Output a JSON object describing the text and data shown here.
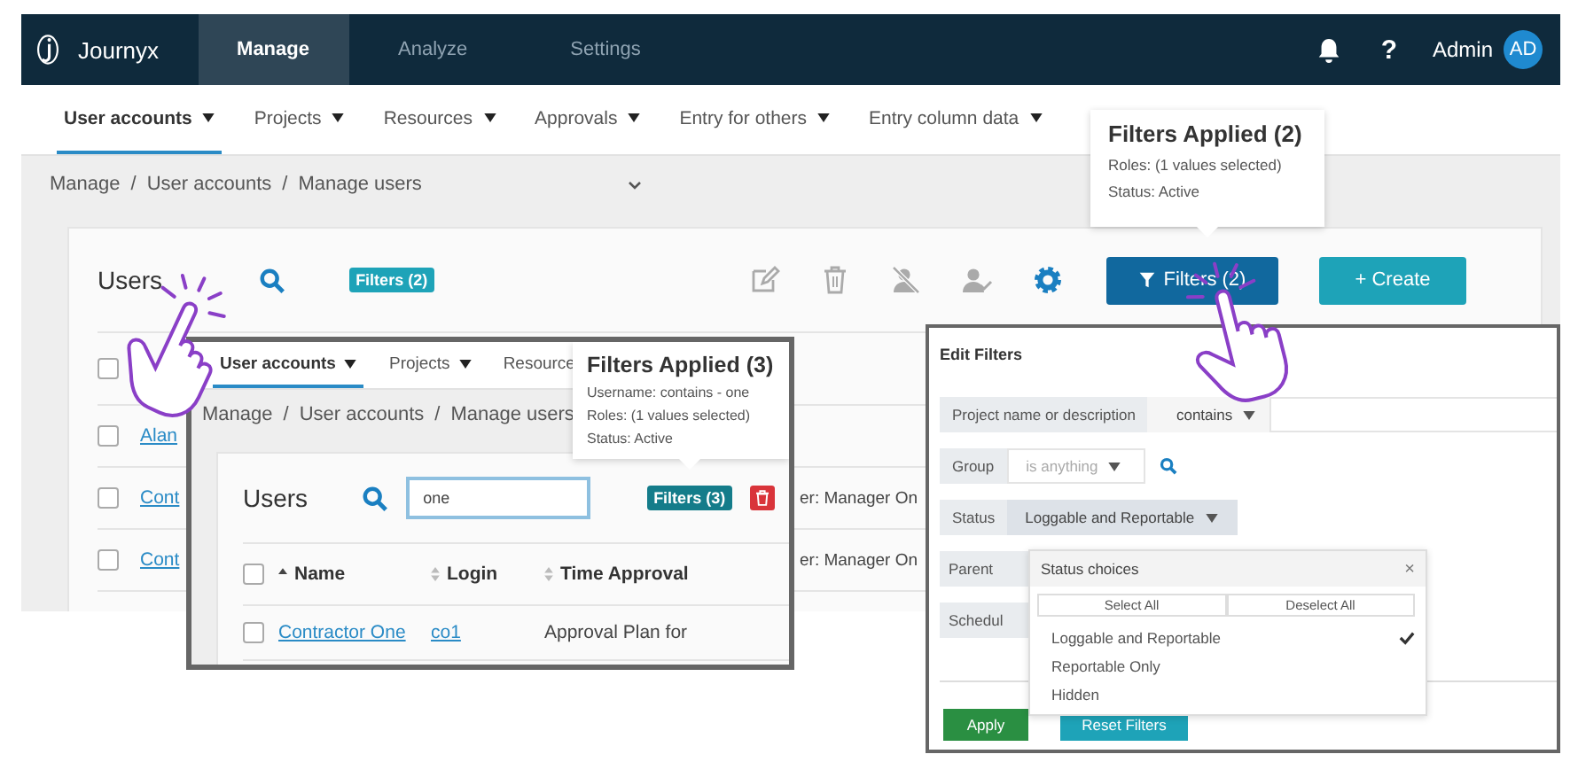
{
  "top_bar": {
    "brand": "Journyx",
    "tabs": [
      {
        "label": "Manage",
        "selected": true
      },
      {
        "label": "Analyze",
        "selected": false
      },
      {
        "label": "Settings",
        "selected": false
      }
    ],
    "help": "?",
    "user": "Admin",
    "avatar": "AD"
  },
  "subnav": [
    {
      "label": "User accounts",
      "selected": true
    },
    {
      "label": "Projects",
      "selected": false
    },
    {
      "label": "Resources",
      "selected": false
    },
    {
      "label": "Approvals",
      "selected": false
    },
    {
      "label": "Entry for others",
      "selected": false
    },
    {
      "label": "Entry column data",
      "selected": false
    }
  ],
  "breadcrumb": {
    "items": [
      "Manage",
      "User accounts",
      "Manage users"
    ],
    "separator": "/"
  },
  "filters_tooltip": {
    "title": "Filters Applied (2)",
    "lines": [
      "Roles: (1 values selected)",
      "Status: Active"
    ]
  },
  "users_card": {
    "title": "Users",
    "filter_badge": "Filters (2)",
    "filters_button": "Filters (2)",
    "create_button": "+ Create",
    "header_checked": false,
    "rows": [
      {
        "name": "Alan",
        "checked": false
      },
      {
        "name": "Cont",
        "column_3": "er: Manager On",
        "checked": false
      },
      {
        "name": "Cont",
        "column_3": "er: Manager On",
        "checked": false
      }
    ]
  },
  "search_inset": {
    "subnav": [
      {
        "label": "User accounts",
        "selected": true,
        "menu": true
      },
      {
        "label": "Projects",
        "selected": false,
        "menu": true
      },
      {
        "label": "Resource",
        "selected": false,
        "menu": false
      }
    ],
    "breadcrumb": {
      "items": [
        "Manage",
        "User accounts",
        "Manage users"
      ],
      "separator": "/"
    },
    "tooltip": {
      "title": "Filters Applied (3)",
      "lines": [
        "Username: contains - one",
        "Roles: (1 values selected)",
        "Status: Active"
      ]
    },
    "title": "Users",
    "search_value": "one",
    "filter_badge": "Filters (3)",
    "header_checked": false,
    "columns": [
      {
        "label": "Name",
        "sorted": true
      },
      {
        "label": "Login",
        "sorted": false
      },
      {
        "label": "Time Approval",
        "sorted": false
      }
    ],
    "rows": [
      {
        "name": "Contractor One",
        "login": "co1",
        "column_3": "Approval Plan for",
        "checked": false
      }
    ]
  },
  "edit_filters": {
    "title": "Edit Filters",
    "rows": [
      {
        "kind": "operator-input",
        "label": "Project name or description",
        "value": "contains",
        "disabled": false
      },
      {
        "kind": "select-search",
        "label": "Group",
        "value": "is anything",
        "disabled": true
      },
      {
        "kind": "select",
        "label": "Status",
        "value": "Loggable and Reportable",
        "disabled": false
      },
      {
        "kind": "label",
        "label": "Parent"
      },
      {
        "kind": "label",
        "label": "Schedul"
      }
    ],
    "status_popup": {
      "title": "Status choices",
      "close": "×",
      "buttons": [
        "Select All",
        "Deselect All"
      ],
      "options": [
        {
          "label": "Loggable and Reportable",
          "checked": true
        },
        {
          "label": "Reportable Only",
          "checked": false
        },
        {
          "label": "Hidden",
          "checked": false
        }
      ]
    },
    "buttons": [
      {
        "label": "Apply",
        "kind": "primary"
      },
      {
        "label": "Reset Filters",
        "kind": "secondary"
      }
    ]
  }
}
